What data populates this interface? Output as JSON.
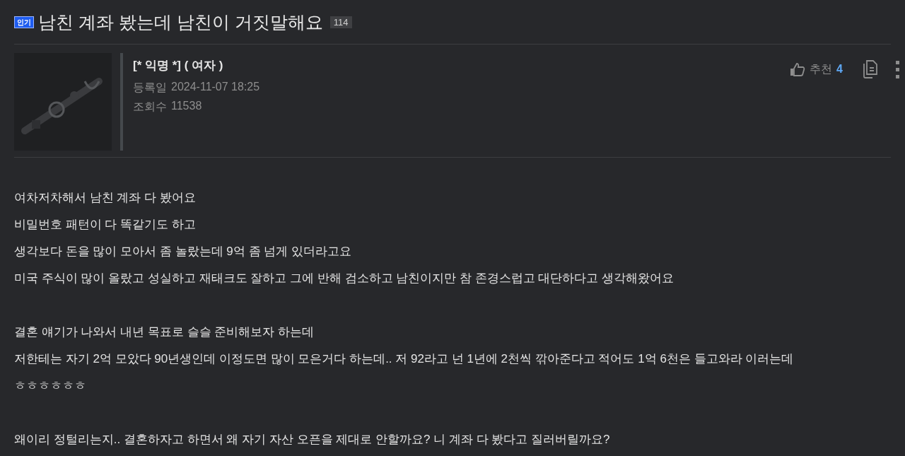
{
  "post": {
    "badge": "인기",
    "title": "남친 계좌 봤는데 남친이 거짓말해요",
    "comment_count": "114"
  },
  "author": {
    "name": "[* 익명 *] ( 여자 )",
    "meta": [
      {
        "label": "등록일",
        "value": "2024-11-07 18:25"
      },
      {
        "label": "조회수",
        "value": "11538"
      }
    ]
  },
  "actions": {
    "recommend_label": "추천",
    "recommend_count": "4"
  },
  "body": [
    [
      "여차저차해서 남친 계좌 다 봤어요",
      "비밀번호 패턴이 다 똑같기도 하고",
      "생각보다 돈을 많이 모아서 좀 놀랐는데 9억 좀 넘게 있더라고요",
      "미국 주식이 많이 올랐고 성실하고 재태크도 잘하고 그에 반해 검소하고 남친이지만 참 존경스럽고 대단하다고 생각해왔어요"
    ],
    [
      "결혼 얘기가 나와서 내년 목표로 슬슬 준비해보자 하는데",
      "저한테는 자기 2억 모았다 90년생인데 이정도면 많이 모은거다 하는데.. 저 92라고 넌 1년에 2천씩 깎아준다고 적어도 1억 6천은 들고와라 이러는데",
      "ㅎㅎㅎㅎㅎㅎ"
    ],
    [
      "왜이리 정털리는지.. 결혼하자고 하면서 왜 자기 자산 오픈을 제대로 안할까요?  니 계좌 다 봤다고 질러버릴까요?"
    ]
  ]
}
